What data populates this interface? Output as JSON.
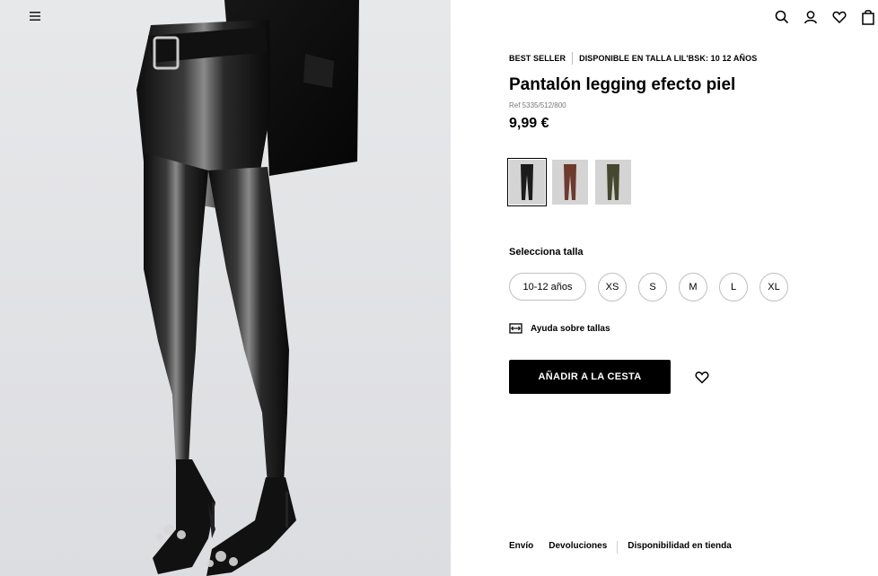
{
  "header": {
    "menu_icon": "hamburger-icon",
    "icons": [
      "search-icon",
      "user-icon",
      "heart-icon",
      "bag-icon"
    ]
  },
  "product": {
    "badges": [
      "BEST SELLER",
      "DISPONIBLE EN TALLA LIL'BSK: 10 12 AÑOS"
    ],
    "title": "Pantalón legging efecto piel",
    "ref": "Ref 5335/512/800",
    "price": "9,99 €",
    "colors": [
      {
        "name": "black",
        "hex": "#1c1c1c",
        "selected": true
      },
      {
        "name": "brown",
        "hex": "#6e3a2c",
        "selected": false
      },
      {
        "name": "khaki",
        "hex": "#46472f",
        "selected": false
      }
    ],
    "size_label": "Selecciona talla",
    "sizes": [
      "10-12 años",
      "XS",
      "S",
      "M",
      "L",
      "XL"
    ],
    "size_help": "Ayuda sobre tallas",
    "add_to_cart": "AÑADIR A LA CESTA"
  },
  "footer": {
    "links": [
      "Envío",
      "Devoluciones",
      "Disponibilidad en tienda"
    ]
  }
}
